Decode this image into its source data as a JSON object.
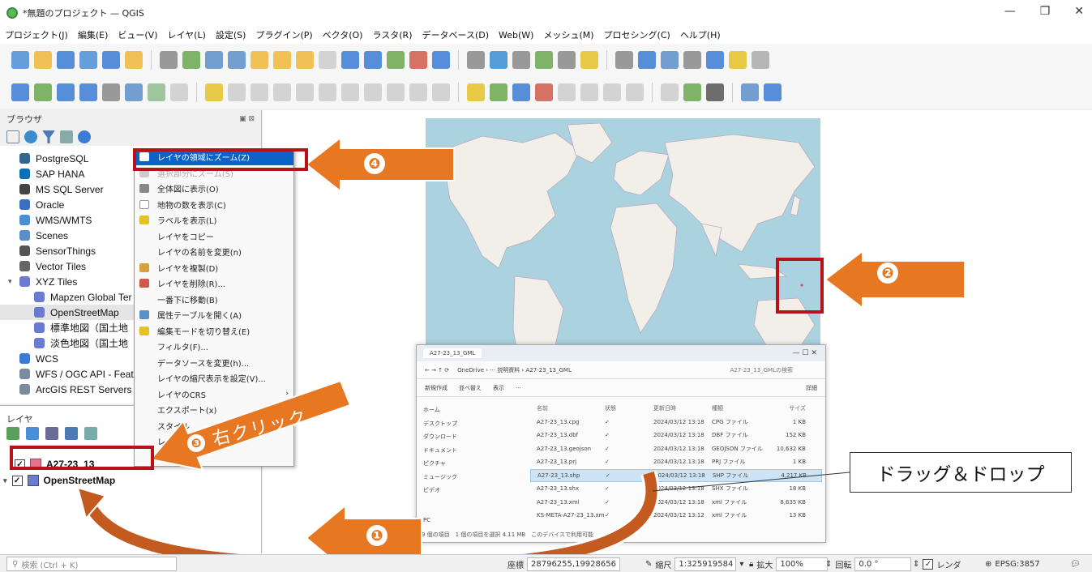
{
  "window": {
    "title": "*無題のプロジェクト — QGIS",
    "minimize": "—",
    "maximize": "❐",
    "close": "✕"
  },
  "menu": [
    "プロジェクト(J)",
    "編集(E)",
    "ビュー(V)",
    "レイヤ(L)",
    "設定(S)",
    "プラグイン(P)",
    "ベクタ(O)",
    "ラスタ(R)",
    "データベース(D)",
    "Web(W)",
    "メッシュ(M)",
    "プロセシング(C)",
    "ヘルプ(H)"
  ],
  "browser": {
    "title": "ブラウザ",
    "items": [
      {
        "label": "PostgreSQL",
        "icon": "postgresql-icon",
        "color": "#336791"
      },
      {
        "label": "SAP HANA",
        "icon": "sap-hana-icon",
        "color": "#0b6fb8"
      },
      {
        "label": "MS SQL Server",
        "icon": "mssql-icon",
        "color": "#444"
      },
      {
        "label": "Oracle",
        "icon": "oracle-icon",
        "color": "#3b6fc2"
      },
      {
        "label": "WMS/WMTS",
        "icon": "wms-icon",
        "color": "#4a8fd6"
      },
      {
        "label": "Scenes",
        "icon": "scenes-icon",
        "color": "#5b8fc9"
      },
      {
        "label": "SensorThings",
        "icon": "sensorthings-icon",
        "color": "#555"
      },
      {
        "label": "Vector Tiles",
        "icon": "vector-tiles-icon",
        "color": "#666"
      },
      {
        "label": "XYZ Tiles",
        "icon": "xyz-tiles-icon",
        "color": "#6a7bd1"
      },
      {
        "label": "Mapzen Global Ter",
        "icon": "xyz-tile-icon",
        "color": "#6a7bd1"
      },
      {
        "label": "OpenStreetMap",
        "icon": "xyz-tile-icon",
        "color": "#6a7bd1"
      },
      {
        "label": "標準地図（国土地",
        "icon": "xyz-tile-icon",
        "color": "#6a7bd1"
      },
      {
        "label": "淡色地図（国土地",
        "icon": "xyz-tile-icon",
        "color": "#6a7bd1"
      },
      {
        "label": "WCS",
        "icon": "wcs-icon",
        "color": "#3a7bd5"
      },
      {
        "label": "WFS / OGC API - Feat",
        "icon": "wfs-icon",
        "color": "#7b8a9c"
      },
      {
        "label": "ArcGIS REST Servers",
        "icon": "arcgis-icon",
        "color": "#7b8a9c"
      }
    ]
  },
  "layers": {
    "title": "レイヤ",
    "items": [
      {
        "label": "A27-23_13",
        "checked": "✓"
      },
      {
        "label": "OpenStreetMap",
        "checked": "✓"
      }
    ]
  },
  "context_menu": [
    {
      "label": "レイヤの領域にズーム(Z)",
      "state": "highlight",
      "icon_color": "#fff"
    },
    {
      "label": "選択部分にズーム(S)",
      "state": "disabled",
      "icon_color": "#ccc"
    },
    {
      "label": "全体図に表示(O)",
      "state": "normal",
      "icon_color": "#888"
    },
    {
      "label": "地物の数を表示(C)",
      "state": "normal",
      "icon_color": "#fff"
    },
    {
      "label": "ラベルを表示(L)",
      "state": "normal",
      "icon_color": "#e6c229"
    },
    {
      "label": "レイヤをコピー",
      "state": "normal",
      "icon_color": ""
    },
    {
      "label": "レイヤの名前を変更(n)",
      "state": "normal",
      "icon_color": ""
    },
    {
      "label": "レイヤを複製(D)",
      "state": "normal",
      "icon_color": "#d8a03c"
    },
    {
      "label": "レイヤを削除(R)...",
      "state": "normal",
      "icon_color": "#d05a4a"
    },
    {
      "label": "一番下に移動(B)",
      "state": "normal",
      "icon_color": ""
    },
    {
      "label": "属性テーブルを開く(A)",
      "state": "normal",
      "icon_color": "#5b8fc9"
    },
    {
      "label": "編集モードを切り替え(E)",
      "state": "normal",
      "icon_color": "#e6c229"
    },
    {
      "label": "フィルタ(F)...",
      "state": "normal",
      "icon_color": ""
    },
    {
      "label": "データソースを変更(h)...",
      "state": "normal",
      "icon_color": ""
    },
    {
      "label": "レイヤの縮尺表示を設定(V)...",
      "state": "normal",
      "icon_color": ""
    },
    {
      "label": "レイヤのCRS",
      "state": "submenu",
      "icon_color": ""
    },
    {
      "label": "エクスポート(x)",
      "state": "submenu",
      "icon_color": ""
    },
    {
      "label": "スタイル",
      "state": "submenu",
      "icon_color": ""
    },
    {
      "label": "レ",
      "state": "normal",
      "icon_color": ""
    },
    {
      "label": "プロ",
      "state": "normal",
      "icon_color": ""
    }
  ],
  "explorer": {
    "tab": "A27-23_13_GML",
    "path": "OneDrive › ··· 説明資料 › A27-23_13_GML",
    "search": "A27-23_13_GMLの検索",
    "toolbar": [
      "新規作成",
      "並べ替え",
      "表示",
      "···",
      "詳細"
    ],
    "headers": [
      "名前",
      "状態",
      "更新日時",
      "種類",
      "サイズ"
    ],
    "sidebar": [
      "ホーム",
      "デスクトップ",
      "ダウンロード",
      "ドキュメント",
      "ピクチャ",
      "ミュージック",
      "ビデオ",
      "PC"
    ],
    "files": [
      {
        "name": "A27-23_13.cpg",
        "status": "✓",
        "date": "2024/03/12 13:18",
        "type": "CPG ファイル",
        "size": "1 KB"
      },
      {
        "name": "A27-23_13.dbf",
        "status": "✓",
        "date": "2024/03/12 13:18",
        "type": "DBF ファイル",
        "size": "152 KB"
      },
      {
        "name": "A27-23_13.geojson",
        "status": "✓",
        "date": "2024/03/12 13:18",
        "type": "GEOJSON ファイル",
        "size": "10,632 KB"
      },
      {
        "name": "A27-23_13.prj",
        "status": "✓",
        "date": "2024/03/12 13:18",
        "type": "PRJ ファイル",
        "size": "1 KB"
      },
      {
        "name": "A27-23_13.shp",
        "status": "✓",
        "date": "2024/03/12 13:18",
        "type": "SHP ファイル",
        "size": "4,217 KB"
      },
      {
        "name": "A27-23_13.shx",
        "status": "✓",
        "date": "2024/03/12 13:18",
        "type": "SHX ファイル",
        "size": "18 KB"
      },
      {
        "name": "A27-23_13.xml",
        "status": "✓",
        "date": "2024/03/12 13:18",
        "type": "xml ファイル",
        "size": "8,635 KB"
      },
      {
        "name": "KS-META-A27-23_13.xml",
        "status": "✓",
        "date": "2024/03/12 13:12",
        "type": "xml ファイル",
        "size": "13 KB"
      }
    ],
    "status": "9 個の項目　1 個の項目を選択 4.11 MB　このデバイスで利用可能"
  },
  "annotations": {
    "step1": "❶",
    "step2": "❷",
    "step3_badge": "❸",
    "step3_text": "右クリック",
    "step4": "❹",
    "drag_drop": "ドラッグ＆ドロップ"
  },
  "status_bar": {
    "search_placeholder": "検索 (Ctrl + K)",
    "coord_label": "座標",
    "coord_value": "28796255,19928656",
    "scale_label": "縮尺",
    "scale_value": "1:325919584",
    "magnifier_label": "拡大",
    "magnifier_value": "100%",
    "rotation_label": "回転",
    "rotation_value": "0.0 °",
    "render_label": "レンダ",
    "crs": "EPSG:3857"
  },
  "colors": {
    "accent_orange": "#e87722",
    "annotation_red": "#b5121b",
    "highlight_blue": "#0a64c8",
    "ocean": "#aad3df",
    "land": "#f2efe9"
  }
}
